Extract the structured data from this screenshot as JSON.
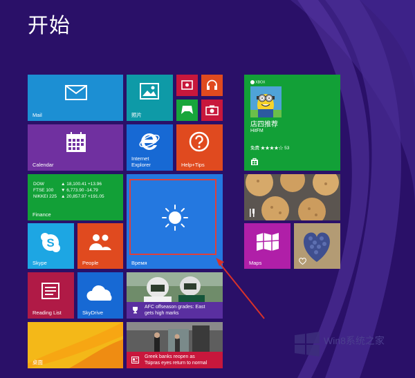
{
  "start": {
    "title": "开始"
  },
  "tiles": {
    "mail": {
      "label": "Mail",
      "color": "#1c8fd3"
    },
    "photos": {
      "label": "照片",
      "color": "#0e9aa7"
    },
    "video": {
      "color": "#c8173c"
    },
    "music": {
      "color": "#e04a1f"
    },
    "games": {
      "color": "#17a63b"
    },
    "camera": {
      "color": "#c8173c"
    },
    "calendar": {
      "label": "Calendar",
      "color": "#7030a0"
    },
    "ie": {
      "label": "Internet Explorer",
      "label_line1": "Internet",
      "label_line2": "Explorer",
      "color": "#1769d4"
    },
    "help": {
      "label": "Help+Tips",
      "color": "#e04a1f"
    },
    "finance": {
      "label": "Finance",
      "color": "#12a037",
      "rows": [
        {
          "name": "DOW",
          "value": "▲ 18,100.41 +13.96"
        },
        {
          "name": "FTSE 100",
          "value": "▼ 6,773.90 -14.79"
        },
        {
          "name": "NIKKEI 225",
          "value": "▲ 20,857.97 +191.05"
        }
      ]
    },
    "weather": {
      "label": "Время",
      "color": "#2478e0"
    },
    "skype": {
      "label": "Skype",
      "color": "#1da6e3"
    },
    "people": {
      "label": "People",
      "color": "#e04a1f"
    },
    "readinglist": {
      "label": "Reading List",
      "color": "#b01a46"
    },
    "skydrive": {
      "label": "SkyDrive",
      "color": "#1769d4"
    },
    "sports": {
      "caption": "AFC offseason grades: East gets high marks",
      "caption_line1": "AFC offseason grades: East",
      "caption_line2": "gets high marks",
      "color": "#5a2fa0"
    },
    "desktop": {
      "label": "桌面",
      "color": "#f2b617"
    },
    "news": {
      "caption": "Greek banks reopen as Tsipras eyes return to normal",
      "caption_line1": "Greek banks reopen as",
      "caption_line2": "Tsipras eyes return to normal",
      "color": "#c8173c"
    },
    "store": {
      "brand": "XBOX",
      "title": "店四推荐",
      "app": "HitFM",
      "rating": "免费 ★★★★☆ 53",
      "color": "#12a037"
    },
    "food": {
      "color": "#8a6a42"
    },
    "maps": {
      "label": "Maps",
      "color": "#b01fa8"
    },
    "hearts": {
      "color": "#a48a62"
    }
  },
  "watermark": {
    "text": "Win8系统之家"
  }
}
